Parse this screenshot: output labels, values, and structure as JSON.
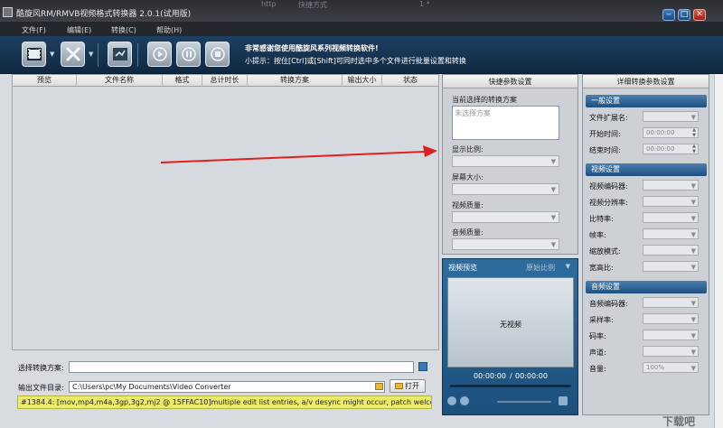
{
  "window": {
    "title": "酷旋风RM/RMVB视频格式转换器 2.0.1(试用版)",
    "bg_text_1": "http",
    "bg_text_2": "快捷方式",
    "bg_text_3": "1 *"
  },
  "menu": [
    "文件(F)",
    "编辑(E)",
    "转换(C)",
    "帮助(H)"
  ],
  "toolbar": {
    "icons": [
      "add-video-icon",
      "remove-icon",
      "convert-icon",
      "play-icon",
      "pause-icon",
      "stop-icon"
    ],
    "banner_title": "非常感谢您使用酷旋风系列视频转换软件!",
    "banner_tip": "小提示：按住[Ctrl]或[Shift]可同时选中多个文件进行批量设置和转换"
  },
  "filelist": {
    "columns": [
      "预览",
      "文件名称",
      "格式",
      "总计时长",
      "转换方案",
      "输出大小",
      "状态"
    ]
  },
  "bottom": {
    "scheme_label": "选择转换方案:",
    "scheme_value": "",
    "output_label": "输出文件目录:",
    "output_path": "C:\\Users\\pc\\My Documents\\Video Converter",
    "open_button": "打开",
    "status_text": "#1384.4: [mov,mp4,m4a,3gp,3g2,mj2 @ 15FFAC10]multiple edit list entries, a/v desync might occur, patch welcome"
  },
  "quick": {
    "title": "快捷参数设置",
    "scheme_label": "当前选择的转换方案",
    "scheme_placeholder": "未选择方案",
    "ratio_label": "显示比例:",
    "screen_label": "屏幕大小:",
    "video_quality_label": "视频质量:",
    "audio_quality_label": "音频质量:"
  },
  "preview": {
    "title": "视频预览",
    "ratio": "原始比例",
    "no_video": "无视频",
    "current_time": "00:00:00",
    "separator": "/",
    "total_time": "00:00:00"
  },
  "detail": {
    "title": "详细转换参数设置",
    "general": {
      "title": "一般设置",
      "ext_label": "文件扩展名:",
      "start_label": "开始时间:",
      "start_value": "00:00:00",
      "end_label": "结束时间:",
      "end_value": "00:00:00"
    },
    "video": {
      "title": "视频设置",
      "codec_label": "视频编码器:",
      "resolution_label": "视频分辨率:",
      "bitrate_label": "比特率:",
      "framerate_label": "帧率:",
      "scale_label": "缩放模式:",
      "aspect_label": "宽高比:"
    },
    "audio": {
      "title": "音频设置",
      "codec_label": "音频编码器:",
      "samplerate_label": "采样率:",
      "bitrate_label": "码率:",
      "channels_label": "声道:",
      "volume_label": "音量:",
      "volume_value": "100%"
    }
  },
  "watermark": "下载吧"
}
